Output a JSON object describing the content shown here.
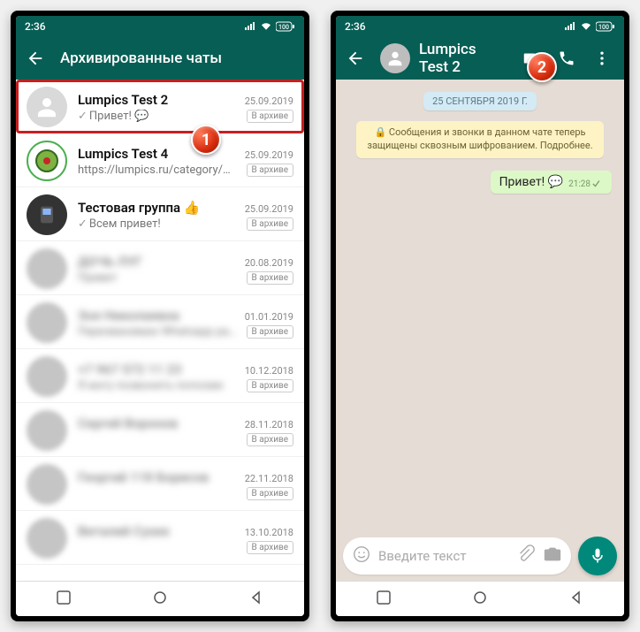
{
  "status": {
    "time": "2:36"
  },
  "left": {
    "header_title": "Архивированные чаты",
    "archive_label": "В архиве",
    "items": [
      {
        "name": "Lumpics Test 2",
        "msg": "Привет! 💬",
        "date": "25.09.2019",
        "highlight": true,
        "tick": true
      },
      {
        "name": "Lumpics Test 4",
        "msg": "https://lumpics.ru/category/w...",
        "date": "25.09.2019"
      },
      {
        "name": "Тестовая группа 👍",
        "msg": "Всем привет!",
        "date": "25.09.2019",
        "tick": true
      },
      {
        "name": "ДОЧЬ ЛУГ",
        "msg": "Привет",
        "date": "20.08.2019",
        "blurred": true
      },
      {
        "name": "Зоя Николаевна",
        "msg": "Перезваниваю Whatsapp работает",
        "date": "01.01.2019",
        "blurred": true
      },
      {
        "name": "+7 967 572 11 23",
        "msg": "Я могу позвонить попозже",
        "date": "10.12.2018",
        "blurred": true
      },
      {
        "name": "Сергей Воронов",
        "msg": "",
        "date": "28.11.2018",
        "blurred": true
      },
      {
        "name": "Георгий 118 Борисов",
        "msg": "",
        "date": "22.11.2018",
        "blurred": true
      },
      {
        "name": "Виталий Сухих",
        "msg": "",
        "date": "13.10.2018",
        "blurred": true
      }
    ]
  },
  "right": {
    "header_title": "Lumpics Test 2",
    "date_pill": "25 СЕНТЯБРЯ 2019 Г.",
    "info_text": "🔒 Сообщения и звонки в данном чате теперь защищены сквозным шифрованием. Подробнее.",
    "message": {
      "text": "Привет! 💬",
      "time": "21:28"
    },
    "composer_placeholder": "Введите текст"
  },
  "badges": {
    "one": "1",
    "two": "2"
  }
}
